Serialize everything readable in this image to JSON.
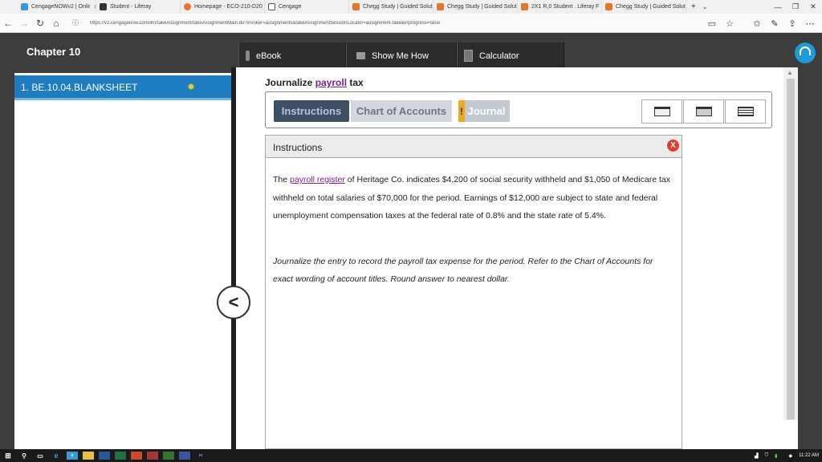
{
  "browser": {
    "tabs": [
      {
        "label": "CengageNOWv2 | Onlir",
        "icon_color": "#3a9ad9",
        "closable": true
      },
      {
        "label": "Student - Liferay",
        "icon_color": "#333333"
      },
      {
        "label": "Homepage - ECO-210-D20",
        "icon_color": "#e8752a"
      },
      {
        "label": "Cengage",
        "icon_color": "#555555"
      },
      {
        "label": "Chegg Study | Guided Solut",
        "icon_color": "#e8752a"
      },
      {
        "label": "Chegg Study | Guided Solut",
        "icon_color": "#e8752a"
      },
      {
        "label": "2X1 R,0 Student . Liferay F",
        "icon_color": "#e8752a"
      },
      {
        "label": "Chegg Study | Guided Solut",
        "icon_color": "#e8752a"
      }
    ],
    "url": "https://v2.cengagenow.com/ilrn/takeAssignment/takeAssignmentMain.do?invoker=assignments&takeAssignmentSessionLocator=assignment-take&inprogress=false"
  },
  "header": {
    "chapter": "Chapter 10",
    "tools": [
      {
        "label": "eBook",
        "icon": "book-icon"
      },
      {
        "label": "Show Me How",
        "icon": "video-icon"
      },
      {
        "label": "Calculator",
        "icon": "calculator-icon"
      }
    ]
  },
  "sidebar": {
    "items": [
      {
        "label": "1. BE.10.04.BLANKSHEET",
        "status_color": "#c8d84a"
      }
    ]
  },
  "question": {
    "title_prefix": "Journalize ",
    "title_link": "payroll",
    "title_suffix": " tax"
  },
  "tabs": {
    "instructions": "Instructions",
    "chart_of_accounts": "Chart of Accounts",
    "journal": "Journal",
    "journal_warning": "!"
  },
  "instructions_panel": {
    "heading": "Instructions",
    "close_label": "X",
    "p1_prefix": "The ",
    "p1_link": "payroll register",
    "p1_text": " of Heritage Co. indicates $4,200 of social security withheld and $1,050 of Medicare tax withheld on total salaries of $70,000 for the period. Earnings of $12,000 are subject to state and federal unemployment compensation taxes at the federal rate of 0.8% and the state rate of 5.4%.",
    "p2_text": "Journalize the entry to record the payroll tax expense for the period. Refer to the Chart of Accounts for exact wording of account titles. Round answer to nearest dollar."
  },
  "taskbar": {
    "time": "11:22 AM"
  }
}
